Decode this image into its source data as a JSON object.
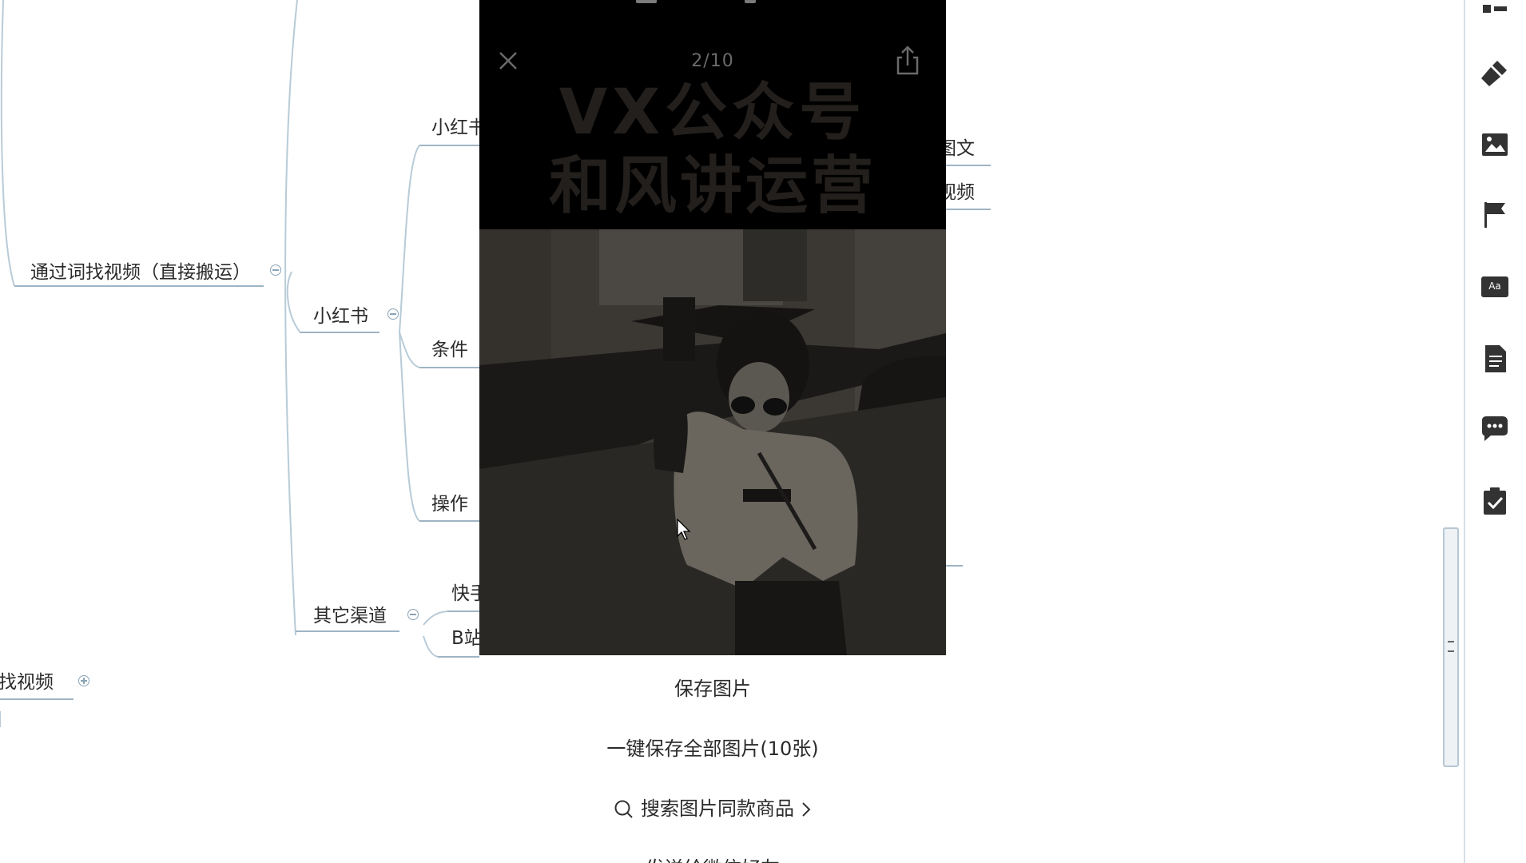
{
  "mindmap": {
    "nodes": {
      "via_word_search": "通过词找视频（直接搬运）",
      "xiaohongshu_main": "小红书",
      "xiaohongshu_sub": "小红书",
      "conditions": "条件",
      "operation": "操作",
      "other_channels": "其它渠道",
      "kuaishou": "快手",
      "bilibili": "B站",
      "find_video": "找视频",
      "tuwen": "图文",
      "shipin": "视频"
    }
  },
  "phone": {
    "page_counter": "2/10",
    "poster_title_line1": "VX公众号",
    "poster_title_line2": "和风讲运营",
    "action_sheet": {
      "save_image": "保存图片",
      "save_all": "一键保存全部图片(10张)",
      "search_similar": "搜索图片同款商品",
      "send_to_friend": "发送给微信好友"
    }
  },
  "colors": {
    "link_line": "#b8cbd8",
    "node_underline": "#9fb4c4",
    "overlay_bg": "#000000",
    "sidebar_icon": "#333333"
  },
  "icons": {
    "close": "close-icon",
    "share": "share-icon",
    "search": "search-icon",
    "chevron": "chevron-right-icon",
    "sidebar": [
      "outline-icon",
      "format-brush-icon",
      "image-icon",
      "flag-icon",
      "text-style-icon",
      "note-icon",
      "comment-icon",
      "task-icon"
    ]
  }
}
